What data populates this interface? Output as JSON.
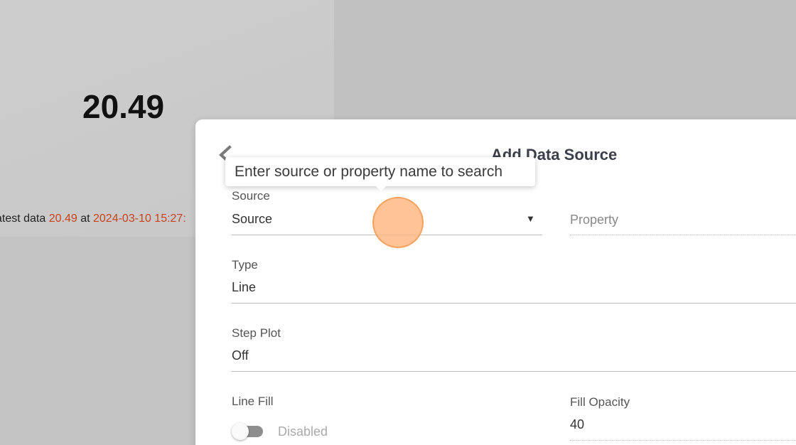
{
  "background": {
    "value": "20.49",
    "latest_prefix": "atest data ",
    "latest_value": "20.49",
    "latest_at": " at ",
    "latest_time": "2024-03-10 15:27:"
  },
  "dialog": {
    "title": "Add Data Source",
    "tooltip": "Enter source or property name to search",
    "source": {
      "label": "Source",
      "value": "Source"
    },
    "property": {
      "placeholder": "Property"
    },
    "type": {
      "label": "Type",
      "value": "Line"
    },
    "step_plot": {
      "label": "Step Plot",
      "value": "Off"
    },
    "line_fill": {
      "label": "Line Fill",
      "state": "Disabled"
    },
    "fill_opacity": {
      "label": "Fill Opacity",
      "value": "40"
    }
  },
  "colors": {
    "accent": "#c8431a",
    "cursor": "#ffb882"
  },
  "icons": {
    "back": "chevron-left-icon",
    "dropdown": "caret-down-icon"
  }
}
